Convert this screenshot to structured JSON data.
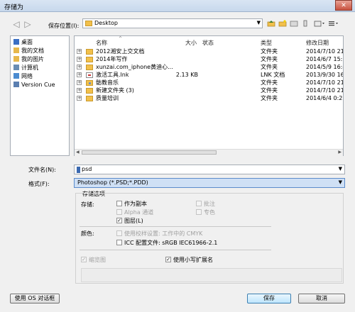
{
  "window": {
    "title": "存储为",
    "close_glyph": "✕"
  },
  "nav": {
    "save_location_label": "保存位置(I):",
    "path": "Desktop",
    "back_glyph": "◁",
    "fwd_glyph": "▷",
    "dropdown_glyph": "▼"
  },
  "toolbar_icons": [
    "go-up-icon",
    "new-folder-icon",
    "folder-icon",
    "library-icon",
    "views-icon",
    "view-menu-icon"
  ],
  "places": [
    {
      "label": "桌面",
      "icon": "desktop-icon",
      "color": "#3a6fc4"
    },
    {
      "label": "我的文档",
      "icon": "documents-icon",
      "color": "#e7b84b"
    },
    {
      "label": "我的图片",
      "icon": "pictures-icon",
      "color": "#e7b84b"
    },
    {
      "label": "计算机",
      "icon": "computer-icon",
      "color": "#6a8db3"
    },
    {
      "label": "网络",
      "icon": "network-icon",
      "color": "#4b8bd0"
    },
    {
      "label": "Version Cue",
      "icon": "version-cue-icon",
      "color": "#5b7fb0"
    }
  ],
  "columns": {
    "name": "名称",
    "size": "大小",
    "status": "状态",
    "type": "类型",
    "modified": "修改日期",
    "sort_glyph": "^"
  },
  "files": [
    {
      "name": "2012湘安上交文档",
      "size": "",
      "type": "文件夹",
      "modified": "2014/7/10 21",
      "kind": "folder"
    },
    {
      "name": "2014年写作",
      "size": "",
      "type": "文件夹",
      "modified": "2014/6/7 15:2",
      "kind": "folder"
    },
    {
      "name": "xunzai.com_iphone黄迪心...",
      "size": "",
      "type": "文件夹",
      "modified": "2014/5/9 16:4",
      "kind": "folder"
    },
    {
      "name": "激活工具.lnk",
      "size": "2.13 KB",
      "type": "LNK 文档",
      "modified": "2013/9/30 16",
      "kind": "lnk"
    },
    {
      "name": "骷教音乐",
      "size": "",
      "type": "文件夹",
      "modified": "2014/7/10 21",
      "kind": "music"
    },
    {
      "name": "新建文件夹 (3)",
      "size": "",
      "type": "文件夹",
      "modified": "2014/7/10 21",
      "kind": "folder"
    },
    {
      "name": "质量培训",
      "size": "",
      "type": "文件夹",
      "modified": "2014/6/4 0:21",
      "kind": "folder"
    }
  ],
  "expand_glyph": "+",
  "filename": {
    "label": "文件名(N):",
    "value": "psd"
  },
  "format": {
    "label": "格式(F):",
    "value": "Photoshop (*.PSD;*.PDD)"
  },
  "options": {
    "group_title": "存储选项",
    "save_label": "存储:",
    "as_copy": {
      "label": "作为副本",
      "checked": false,
      "disabled": false
    },
    "notes": {
      "label": "批注",
      "checked": false,
      "disabled": true
    },
    "alpha": {
      "label": "Alpha 通道",
      "checked": false,
      "disabled": true
    },
    "spot": {
      "label": "专色",
      "checked": false,
      "disabled": true
    },
    "layers": {
      "label": "图层(L)",
      "checked": true,
      "disabled": false
    },
    "color_label": "颜色:",
    "proof": {
      "label": "使用校样设置: 工作中的 CMYK",
      "checked": false,
      "disabled": true
    },
    "icc": {
      "label": "ICC 配置文件: sRGB IEC61966-2.1",
      "checked": false,
      "disabled": false
    },
    "thumbnail": {
      "label": "缩览图",
      "checked": true,
      "disabled": true
    },
    "lowercase_ext": {
      "label": "使用小写扩展名",
      "checked": true,
      "disabled": false
    }
  },
  "buttons": {
    "os_dialog": "使用 OS 对话框",
    "save": "保存",
    "cancel": "取消"
  },
  "check_glyph": "✓"
}
